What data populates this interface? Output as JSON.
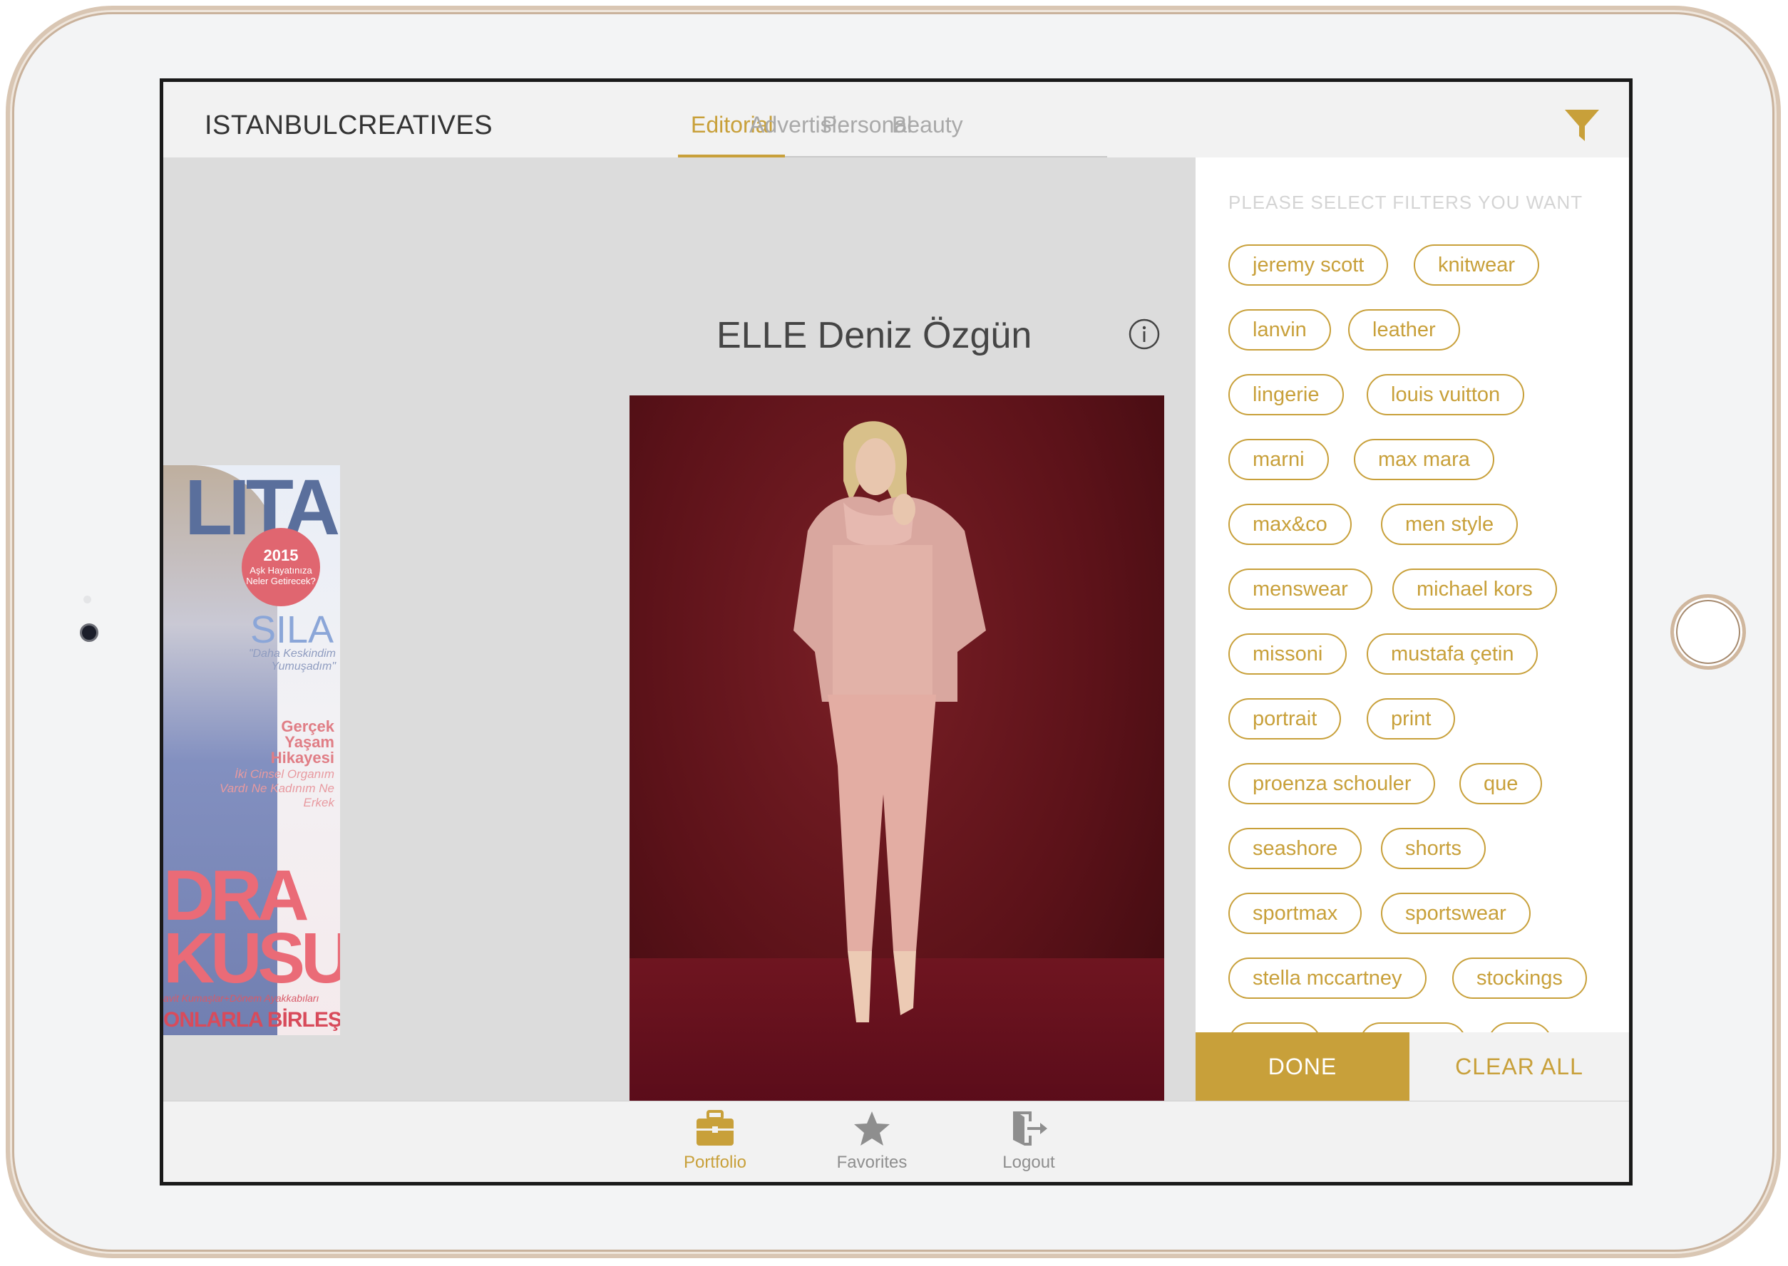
{
  "header": {
    "brand": "ISTANBULCREATIVES",
    "tabs": [
      {
        "label": "Editorial",
        "active": true
      },
      {
        "label": "Advertisi...",
        "active": false
      },
      {
        "label": "Personal",
        "active": false
      },
      {
        "label": "Beauty",
        "active": false
      }
    ],
    "filter_icon": "filter-funnel-icon"
  },
  "main": {
    "item_title": "ELLE Deniz Özgün",
    "info_icon": "info-icon",
    "side_magazine": {
      "masthead": "LITAN",
      "badge_year": "2015",
      "badge_text": "Aşk Hayatınıza Neler Getirecek?",
      "name": "SILA",
      "quote": "\"Daha Keskindim Yumuşadım\"",
      "headline": "Gerçek Yaşam Hikayesi",
      "subline": "İki Cinsel Organım Vardı Ne Kadınım Ne Erkek",
      "big_text": [
        "DRA",
        "KUSU"
      ],
      "small_text": "avit Kumaşlar+Dönem Ayakkabıları",
      "bottom_text": "ONLARLA BİRLEŞTİ"
    }
  },
  "filter_panel": {
    "heading": "PLEASE SELECT FILTERS YOU WANT",
    "chips": [
      "jeremy scott",
      "knitwear",
      "lanvin",
      "leather",
      "lingerie",
      "louis vuitton",
      "marni",
      "max mara",
      "max&co",
      "men style",
      "menswear",
      "michael kors",
      "missoni",
      "mustafa çetin",
      "portrait",
      "print",
      "proenza schouler",
      "que",
      "seashore",
      "shorts",
      "sportmax",
      "sportswear",
      "stella mccartney",
      "stockings"
    ],
    "done_label": "DONE",
    "clear_label": "CLEAR ALL"
  },
  "tabbar": {
    "items": [
      {
        "label": "Portfolio",
        "icon": "briefcase-icon",
        "active": true
      },
      {
        "label": "Favorites",
        "icon": "star-icon",
        "active": false
      },
      {
        "label": "Logout",
        "icon": "logout-icon",
        "active": false
      }
    ]
  },
  "colors": {
    "accent": "#c8a03a",
    "panel_bg": "#ffffff",
    "content_bg": "#dcdcdc"
  }
}
